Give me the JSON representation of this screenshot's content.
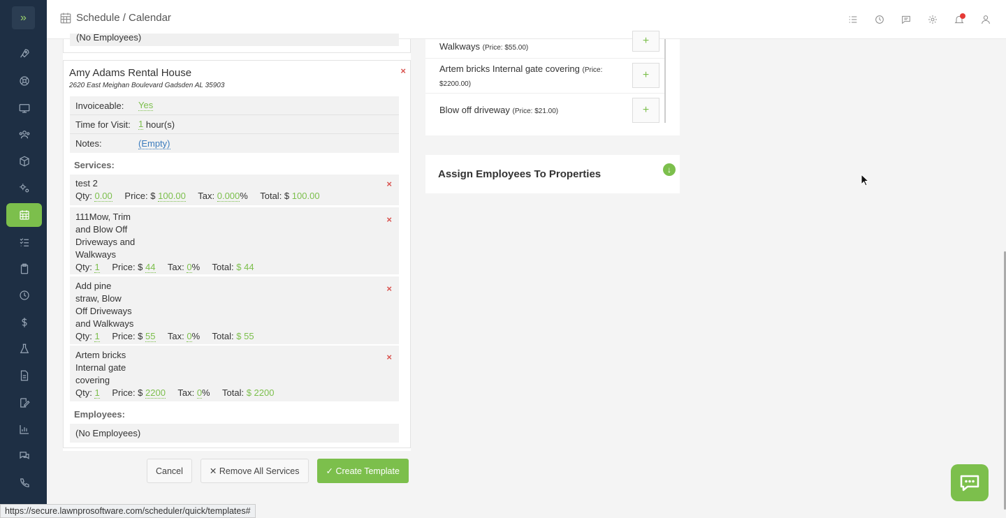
{
  "header": {
    "title": "Schedule / Calendar"
  },
  "top_partial": "(No Employees)",
  "property": {
    "name": "Amy Adams Rental House",
    "address": "2620 East Meighan Boulevard Gadsden AL 35903",
    "close": "×",
    "info": {
      "invoiceable_label": "Invoiceable:",
      "invoiceable_value": "Yes",
      "time_label": "Time for Visit:",
      "time_value": "1",
      "time_unit": "hour(s)",
      "notes_label": "Notes:",
      "notes_value": "(Empty)"
    },
    "services_heading": "Services:",
    "services": [
      {
        "name": "test 2",
        "qty_label": "Qty:",
        "qty": "0.00",
        "price_label": "Price: $",
        "price": "100.00",
        "tax_label": "Tax:",
        "tax": "0.000",
        "pct": "%",
        "total_label": "Total: $",
        "total": "100.00"
      },
      {
        "name_lines": [
          "111Mow, Trim",
          "and Blow Off",
          "Driveways and",
          "Walkways"
        ],
        "qty_label": "Qty:",
        "qty": "1",
        "price_label": "Price: $",
        "price": "44",
        "tax_label": "Tax:",
        "tax": "0",
        "pct": "%",
        "total_label": "Total:",
        "total": "$ 44"
      },
      {
        "name_lines": [
          "Add pine",
          "straw, Blow",
          "Off Driveways",
          "and Walkways"
        ],
        "qty_label": "Qty:",
        "qty": "1",
        "price_label": "Price: $",
        "price": "55",
        "tax_label": "Tax:",
        "tax": "0",
        "pct": "%",
        "total_label": "Total:",
        "total": "$ 55"
      },
      {
        "name_lines": [
          "Artem bricks",
          "Internal gate",
          "covering"
        ],
        "qty_label": "Qty:",
        "qty": "1",
        "price_label": "Price: $",
        "price": "2200",
        "tax_label": "Tax:",
        "tax": "0",
        "pct": "%",
        "total_label": "Total:",
        "total": "$ 2200"
      }
    ],
    "delete_symbol": "×",
    "employees_heading": "Employees:",
    "employees_value": "(No Employees)"
  },
  "buttons": {
    "cancel": "Cancel",
    "remove_all": "✕ Remove All Services",
    "create": "✓ Create Template"
  },
  "service_options": [
    {
      "name": "Walkways",
      "price": "(Price: $55.00)"
    },
    {
      "name": "Artem bricks Internal gate covering",
      "price_a": "(Price:",
      "price_b": "$2200.00)"
    },
    {
      "name": "Blow off driveway",
      "price": "(Price: $21.00)"
    }
  ],
  "add_symbol": "+",
  "assign": {
    "title": "Assign Employees To Properties"
  },
  "status_url": "https://secure.lawnprosoftware.com/scheduler/quick/templates#",
  "colors": {
    "accent": "#7cbf4c",
    "sidebar": "#1e2f44",
    "danger": "#d9534f",
    "link": "#3a7bbd"
  }
}
